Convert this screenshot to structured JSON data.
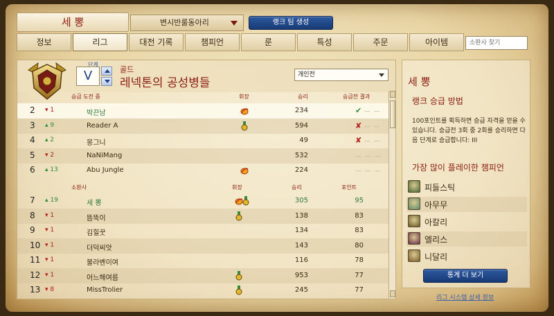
{
  "header": {
    "summoner_name": "세 뽕",
    "team_select": "변시반룰동아리",
    "create_team_button": "랭크 팀 생성"
  },
  "tabs": [
    {
      "label": "정보",
      "active": false
    },
    {
      "label": "리그",
      "active": true
    },
    {
      "label": "대전 기록",
      "active": false
    },
    {
      "label": "챔피언",
      "active": false
    },
    {
      "label": "룬",
      "active": false
    },
    {
      "label": "특성",
      "active": false
    },
    {
      "label": "주문",
      "active": false
    },
    {
      "label": "아이템",
      "active": false
    }
  ],
  "search": {
    "placeholder": "소환사 찾기"
  },
  "league": {
    "tier_label": "단계",
    "division": "V",
    "tier": "골드",
    "name": "레넥톤의 공성병들",
    "queue_select": "개인전",
    "promo_columns": {
      "name": "승급 도전 중",
      "badge": "휘장",
      "wins": "승리",
      "series": "승급전 결과"
    },
    "main_columns": {
      "name": "소환사",
      "badge": "휘장",
      "wins": "승리",
      "points": "포인트"
    },
    "promo_rows": [
      {
        "rank": "2",
        "trend": "▾ 1",
        "trend_dir": "down",
        "name": "박끈남",
        "badges": [
          "flame"
        ],
        "wins": "234",
        "series": [
          "check",
          "dash",
          "dash"
        ]
      },
      {
        "rank": "3",
        "trend": "▴ 9",
        "trend_dir": "up",
        "name": "Reader A",
        "badges": [
          "medal"
        ],
        "wins": "594",
        "series": [
          "x",
          "dash",
          "dash"
        ]
      },
      {
        "rank": "4",
        "trend": "▴ 2",
        "trend_dir": "up",
        "name": "몽그니",
        "badges": [],
        "wins": "49",
        "series": [
          "x",
          "dash",
          "dash"
        ]
      },
      {
        "rank": "5",
        "trend": "▾ 2",
        "trend_dir": "down",
        "name": "NaNiMang",
        "badges": [],
        "wins": "532",
        "series": [
          "dash",
          "dash",
          "dash"
        ]
      },
      {
        "rank": "6",
        "trend": "▴ 13",
        "trend_dir": "up",
        "name": "Abu Jungle",
        "badges": [
          "flame"
        ],
        "wins": "224",
        "series": [
          "dash",
          "dash",
          "dash"
        ]
      }
    ],
    "rows": [
      {
        "rank": "7",
        "trend": "▴ 19",
        "trend_dir": "up",
        "name": "세 뽕",
        "badges": [
          "flame",
          "medal"
        ],
        "wins": "305",
        "points": "95",
        "me": true
      },
      {
        "rank": "8",
        "trend": "▾ 1",
        "trend_dir": "down",
        "name": "뜸뚝이",
        "badges": [
          "medal"
        ],
        "wins": "138",
        "points": "83"
      },
      {
        "rank": "9",
        "trend": "▾ 1",
        "trend_dir": "down",
        "name": "김힐꿋",
        "badges": [],
        "wins": "134",
        "points": "83"
      },
      {
        "rank": "10",
        "trend": "▾ 1",
        "trend_dir": "down",
        "name": "더덕씨앗",
        "badges": [],
        "wins": "143",
        "points": "80"
      },
      {
        "rank": "11",
        "trend": "▾ 1",
        "trend_dir": "down",
        "name": "불라벤이여",
        "badges": [],
        "wins": "116",
        "points": "78"
      },
      {
        "rank": "12",
        "trend": "▾ 1",
        "trend_dir": "down",
        "name": "어느해여름",
        "badges": [
          "medal"
        ],
        "wins": "953",
        "points": "77"
      },
      {
        "rank": "13",
        "trend": "▾ 8",
        "trend_dir": "down",
        "name": "MissTrolier",
        "badges": [
          "medal"
        ],
        "wins": "245",
        "points": "77"
      }
    ]
  },
  "side": {
    "title": "세 뽕",
    "promo_heading": "랭크 승급 방법",
    "promo_text": "100포인트를 획득하면 승급 자격을 얻을 수 있습니다. 승급전 3회 중 2회를 승리하면 다음 단계로 승급합니다: III",
    "champ_heading": "가장 많이 플레이한 챔피언",
    "champions": [
      {
        "name": "피들스틱",
        "color": "#4a6a3a"
      },
      {
        "name": "아무무",
        "color": "#5f8a6a"
      },
      {
        "name": "아칼리",
        "color": "#6a5a2a"
      },
      {
        "name": "엘리스",
        "color": "#6a2a4a"
      },
      {
        "name": "니달리",
        "color": "#7a6030"
      }
    ],
    "stats_button": "통계 더 보기",
    "detail_link": "리그 시스템 상세 정보"
  }
}
